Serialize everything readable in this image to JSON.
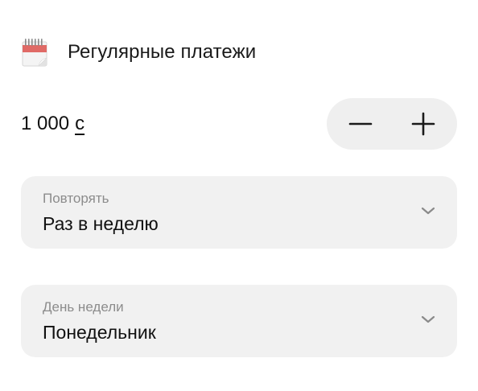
{
  "header": {
    "icon": "calendar-icon",
    "title": "Регулярные платежи"
  },
  "amount": {
    "value": "1 000",
    "currency": "с"
  },
  "stepper": {
    "decrement_icon": "minus-icon",
    "increment_icon": "plus-icon"
  },
  "fields": {
    "repeat": {
      "label": "Повторять",
      "value": "Раз в неделю",
      "icon": "chevron-down-icon"
    },
    "weekday": {
      "label": "День недели",
      "value": "Понедельник",
      "icon": "chevron-down-icon"
    }
  },
  "colors": {
    "field_background": "#f1f1f1",
    "stepper_background": "#efefef",
    "label_text": "#8c8c8c",
    "calendar_accent": "#e06a66"
  }
}
